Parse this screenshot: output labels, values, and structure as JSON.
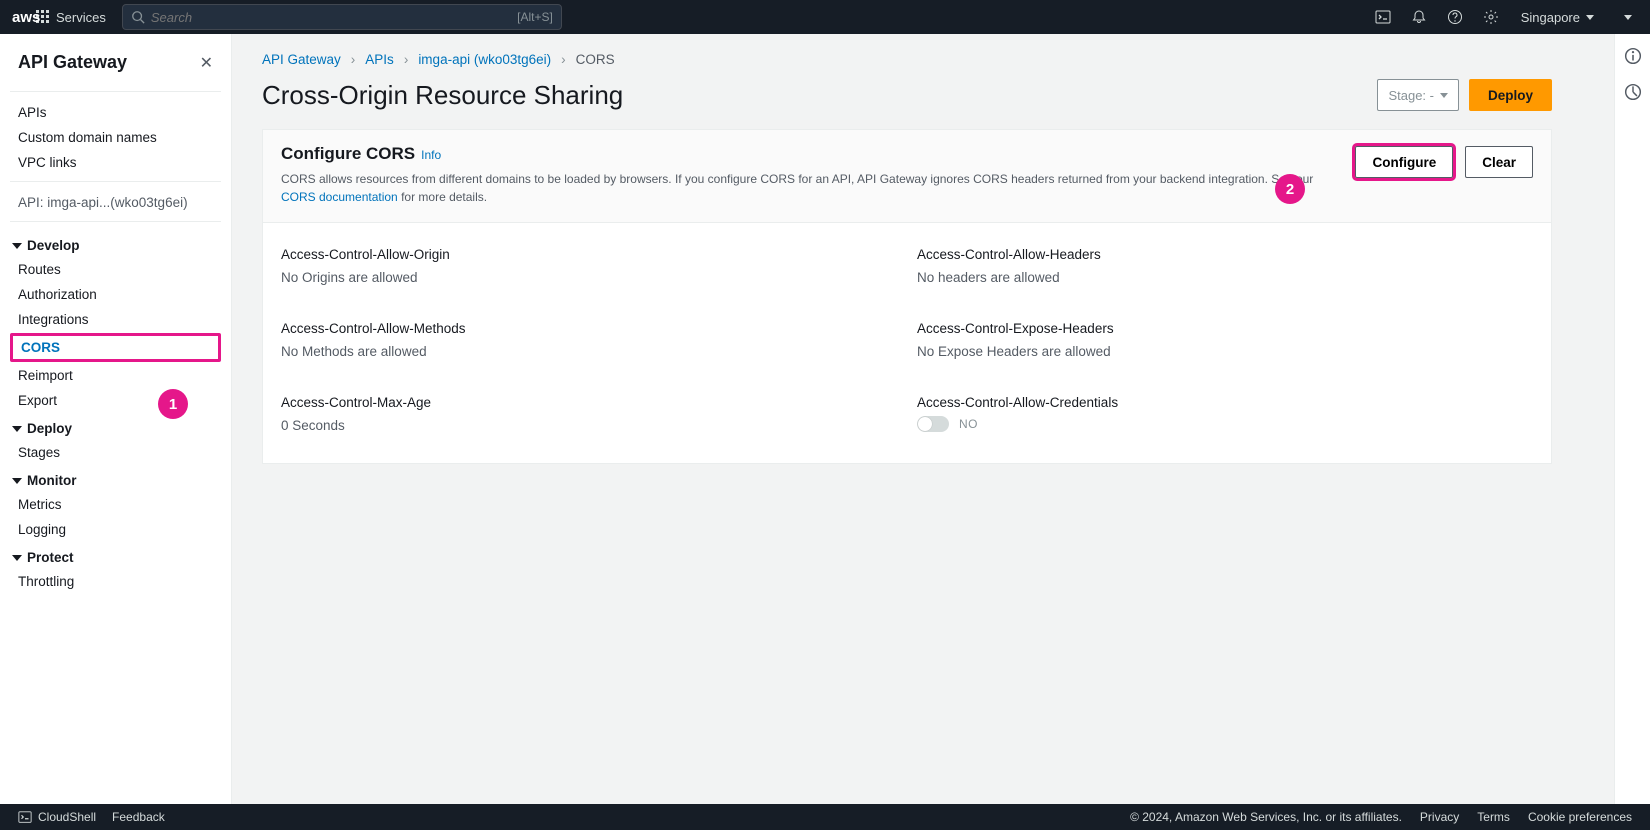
{
  "topnav": {
    "services_label": "Services",
    "search_placeholder": "Search",
    "search_hint": "[Alt+S]",
    "region": "Singapore"
  },
  "sidebar": {
    "title": "API Gateway",
    "items_top": [
      "APIs",
      "Custom domain names",
      "VPC links"
    ],
    "api_context": "API: imga-api...(wko03tg6ei)",
    "sections": {
      "develop": {
        "label": "Develop",
        "items": [
          "Routes",
          "Authorization",
          "Integrations",
          "CORS",
          "Reimport",
          "Export"
        ]
      },
      "deploy": {
        "label": "Deploy",
        "items": [
          "Stages"
        ]
      },
      "monitor": {
        "label": "Monitor",
        "items": [
          "Metrics",
          "Logging"
        ]
      },
      "protect": {
        "label": "Protect",
        "items": [
          "Throttling"
        ]
      }
    }
  },
  "breadcrumb": {
    "items": [
      "API Gateway",
      "APIs",
      "imga-api (wko03tg6ei)",
      "CORS"
    ]
  },
  "page": {
    "title": "Cross-Origin Resource Sharing",
    "stage_label": "Stage: -",
    "deploy_label": "Deploy"
  },
  "cors_panel": {
    "title": "Configure CORS",
    "info_label": "Info",
    "configure_label": "Configure",
    "clear_label": "Clear",
    "desc_part1": "CORS allows resources from different domains to be loaded by browsers. If you configure CORS for an API, API Gateway ignores CORS headers returned from your backend integration. See our ",
    "desc_link": "CORS documentation",
    "desc_part2": " for more details.",
    "fields": {
      "origin": {
        "label": "Access-Control-Allow-Origin",
        "value": "No Origins are allowed"
      },
      "headers": {
        "label": "Access-Control-Allow-Headers",
        "value": "No headers are allowed"
      },
      "methods": {
        "label": "Access-Control-Allow-Methods",
        "value": "No Methods are allowed"
      },
      "expose": {
        "label": "Access-Control-Expose-Headers",
        "value": "No Expose Headers are allowed"
      },
      "maxage": {
        "label": "Access-Control-Max-Age",
        "value": "0 Seconds"
      },
      "credentials": {
        "label": "Access-Control-Allow-Credentials",
        "value": "NO"
      }
    }
  },
  "callouts": {
    "one": "1",
    "two": "2"
  },
  "footer": {
    "cloudshell": "CloudShell",
    "feedback": "Feedback",
    "copyright": "© 2024, Amazon Web Services, Inc. or its affiliates.",
    "privacy": "Privacy",
    "terms": "Terms",
    "cookies": "Cookie preferences"
  }
}
